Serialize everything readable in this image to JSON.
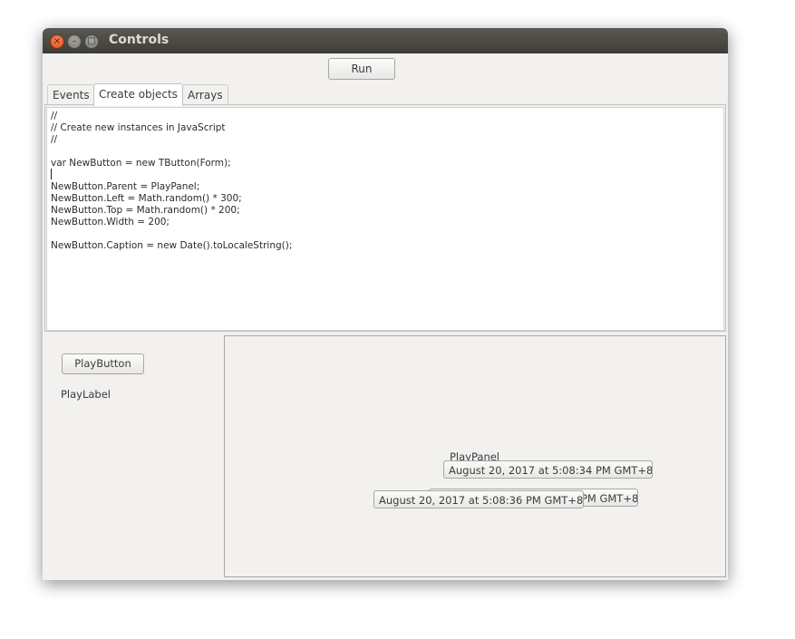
{
  "window": {
    "title": "Controls"
  },
  "toolbar": {
    "run_label": "Run"
  },
  "tabs": [
    {
      "label": "Events",
      "active": false
    },
    {
      "label": "Create objects",
      "active": true
    },
    {
      "label": "Arrays",
      "active": false
    }
  ],
  "editor": {
    "lines": [
      "//",
      "// Create new instances in JavaScript",
      "//",
      "",
      "var NewButton = new TButton(Form);",
      "",
      "NewButton.Parent = PlayPanel;",
      "NewButton.Left = Math.random() * 300;",
      "NewButton.Top = Math.random() * 200;",
      "NewButton.Width = 200;",
      "",
      "NewButton.Caption = new Date().toLocaleString();"
    ]
  },
  "controls": {
    "play_button_label": "PlayButton",
    "play_label_text": "PlayLabel"
  },
  "play_panel": {
    "caption": "PlayPanel",
    "created_buttons": [
      {
        "caption": "August 20, 2017 at 5:08:34 PM GMT+8"
      },
      {
        "caption": "August 20, 2017 at 5:08:35 PM GMT+8"
      },
      {
        "caption": "August 20, 2017 at 5:08:36 PM GMT+8"
      }
    ]
  }
}
